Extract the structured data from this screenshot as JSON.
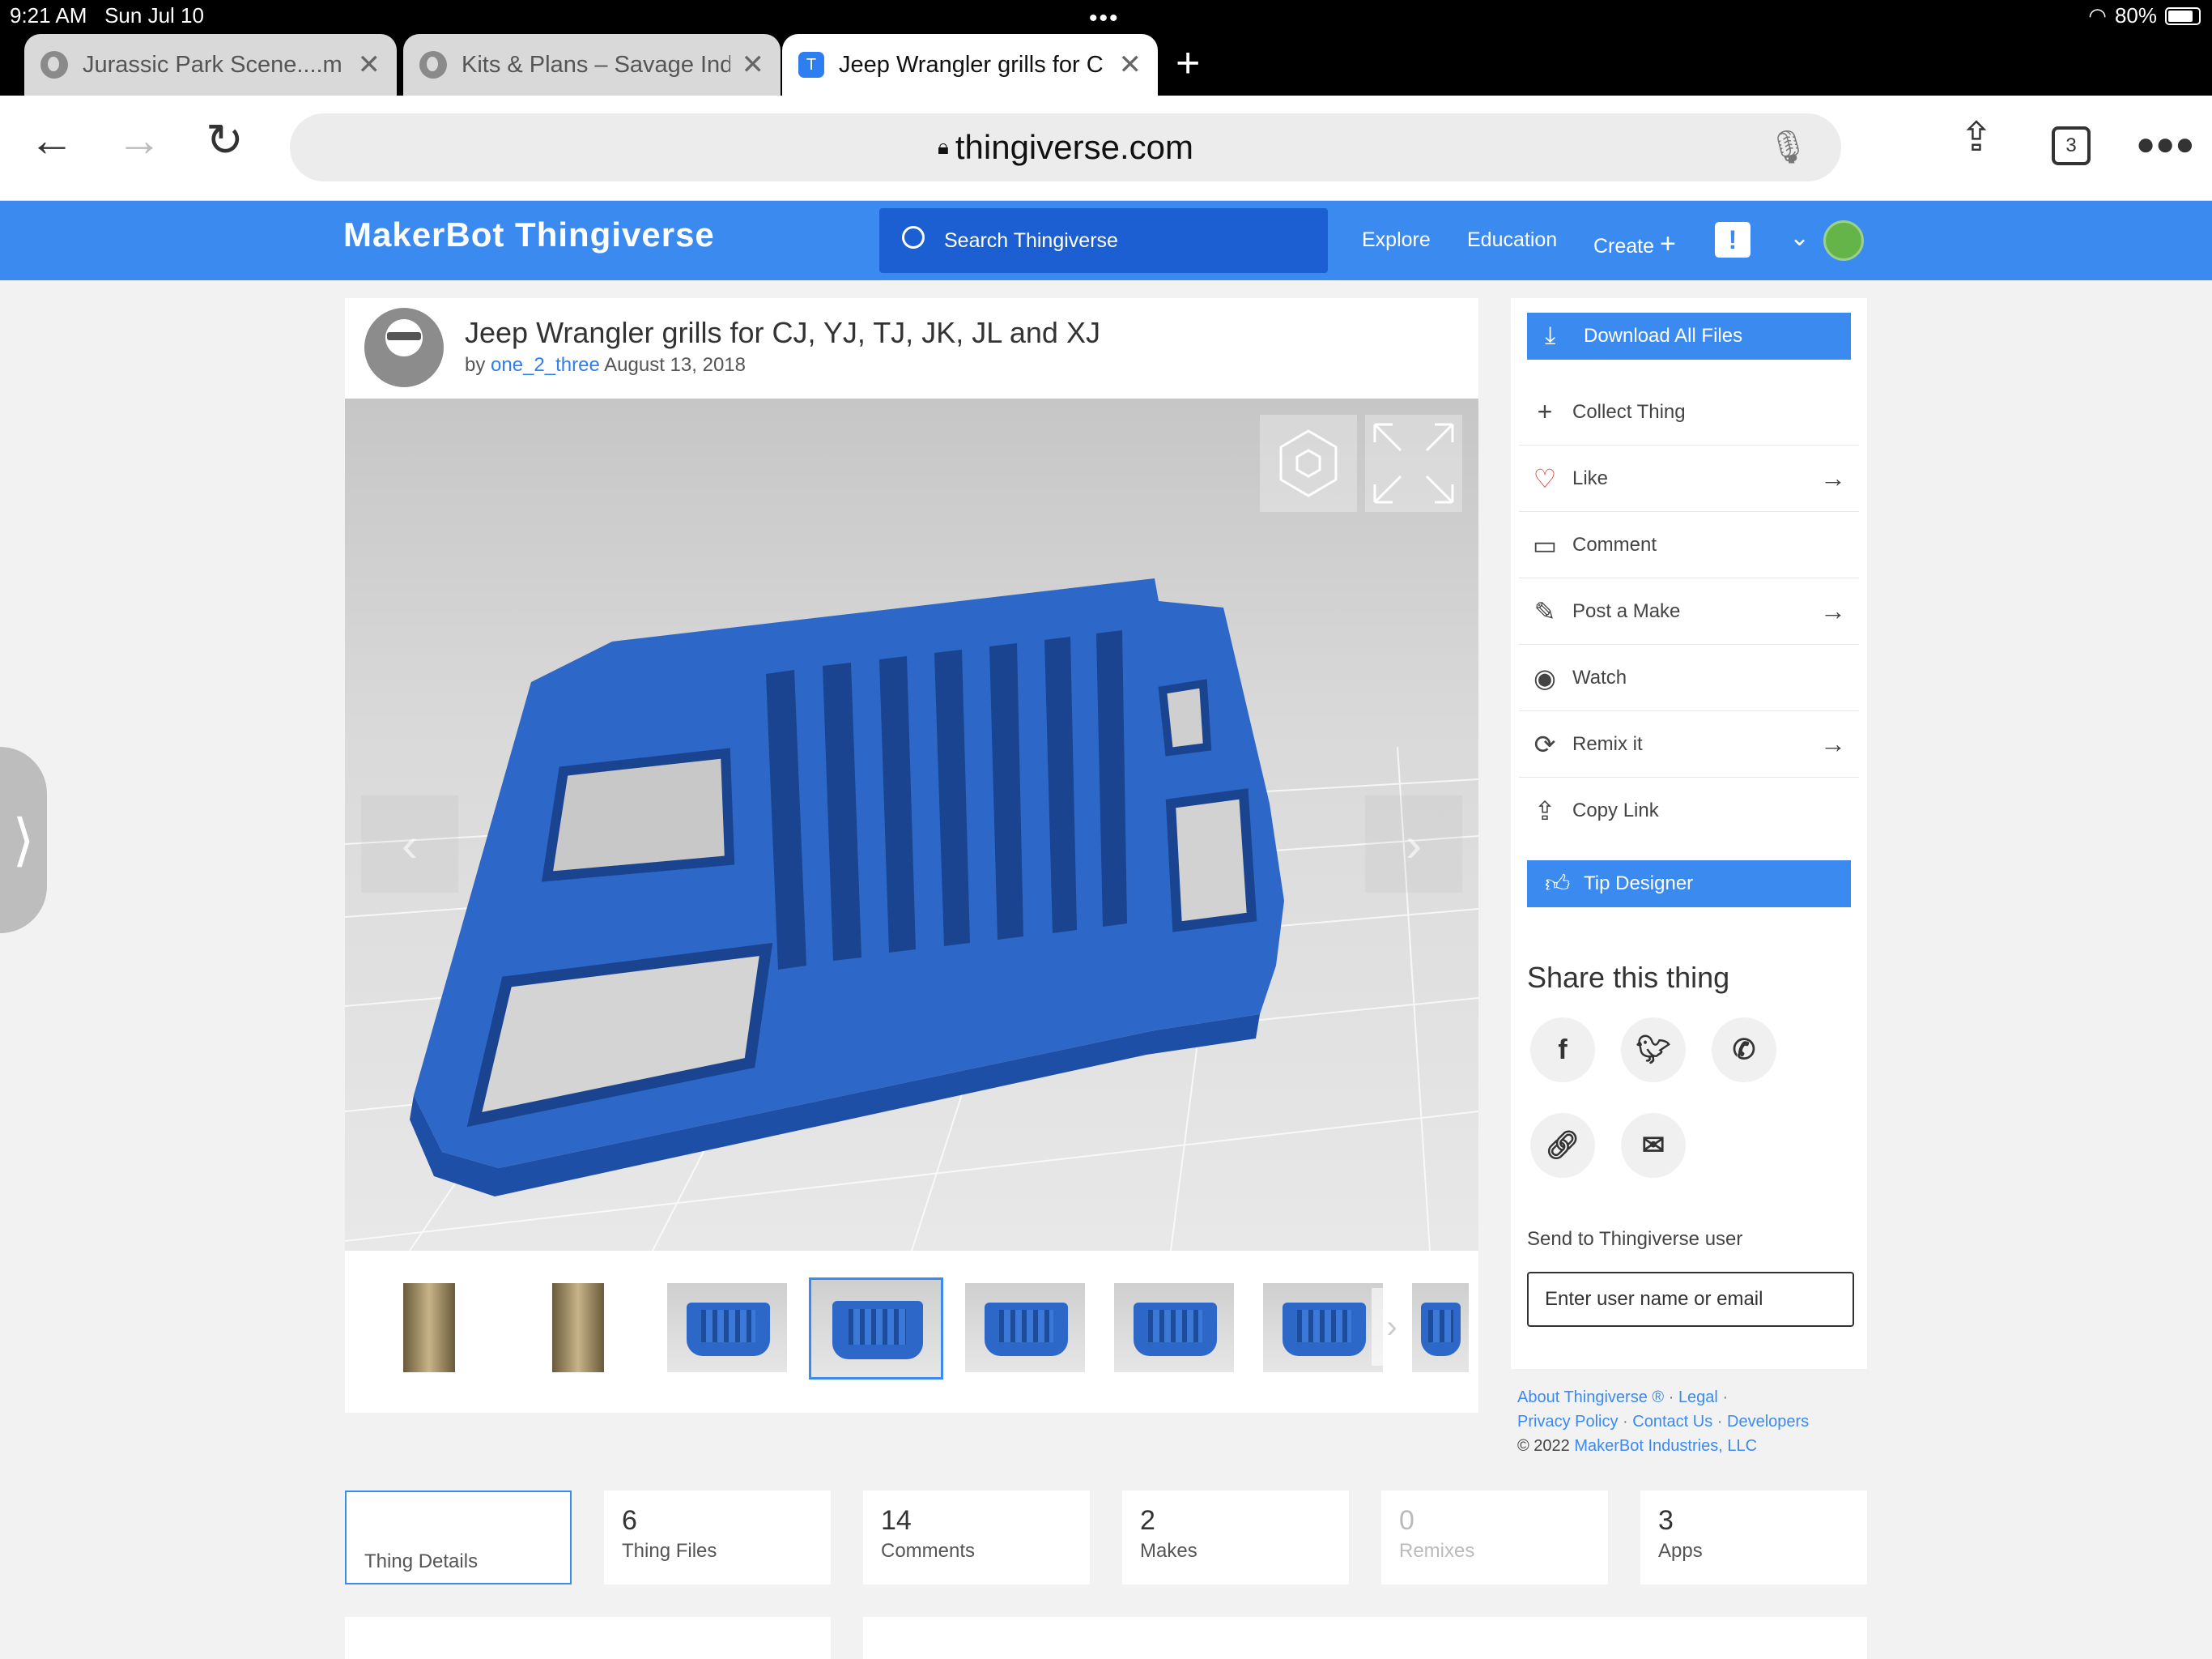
{
  "status": {
    "time": "9:21 AM",
    "date": "Sun Jul 10",
    "battery": "80%"
  },
  "tabs": [
    {
      "title": "Jurassic Park Scene....m"
    },
    {
      "title": "Kits & Plans – Savage Ind"
    },
    {
      "title": "Jeep Wrangler grills for C"
    }
  ],
  "toolbar": {
    "url": "thingiverse.com",
    "tab_count": "3"
  },
  "site": {
    "logo": "MakerBot Thingiverse",
    "search_placeholder": "Search Thingiverse",
    "nav": [
      "Explore",
      "Education",
      "Create"
    ],
    "alert": "!"
  },
  "thing": {
    "title": "Jeep Wrangler grills for CJ, YJ, TJ, JK, JL and XJ",
    "by": "by",
    "author": "one_2_three",
    "date": "August 13, 2018"
  },
  "actions": {
    "download": "Download All Files",
    "items": [
      "Collect Thing",
      "Like",
      "Comment",
      "Post a Make",
      "Watch",
      "Remix it",
      "Copy Link"
    ],
    "tip": "Tip Designer"
  },
  "share": {
    "title": "Share this thing",
    "send_label": "Send to Thingiverse user",
    "send_placeholder": "Enter user name or email"
  },
  "footer": {
    "about": "About Thingiverse ®",
    "legal": "Legal",
    "privacy": "Privacy Policy",
    "contact": "Contact Us",
    "developers": "Developers",
    "copyright": "©  2022",
    "company": "MakerBot Industries, LLC"
  },
  "stats": [
    {
      "num": "",
      "label": "Thing Details"
    },
    {
      "num": "6",
      "label": "Thing Files"
    },
    {
      "num": "14",
      "label": "Comments"
    },
    {
      "num": "2",
      "label": "Makes"
    },
    {
      "num": "0",
      "label": "Remixes"
    },
    {
      "num": "3",
      "label": "Apps"
    }
  ],
  "colors": {
    "brand_blue": "#3a8af0",
    "dark_blue": "#1c5fd3",
    "grill_blue": "#2d68c8",
    "like_red": "#e0342a"
  }
}
